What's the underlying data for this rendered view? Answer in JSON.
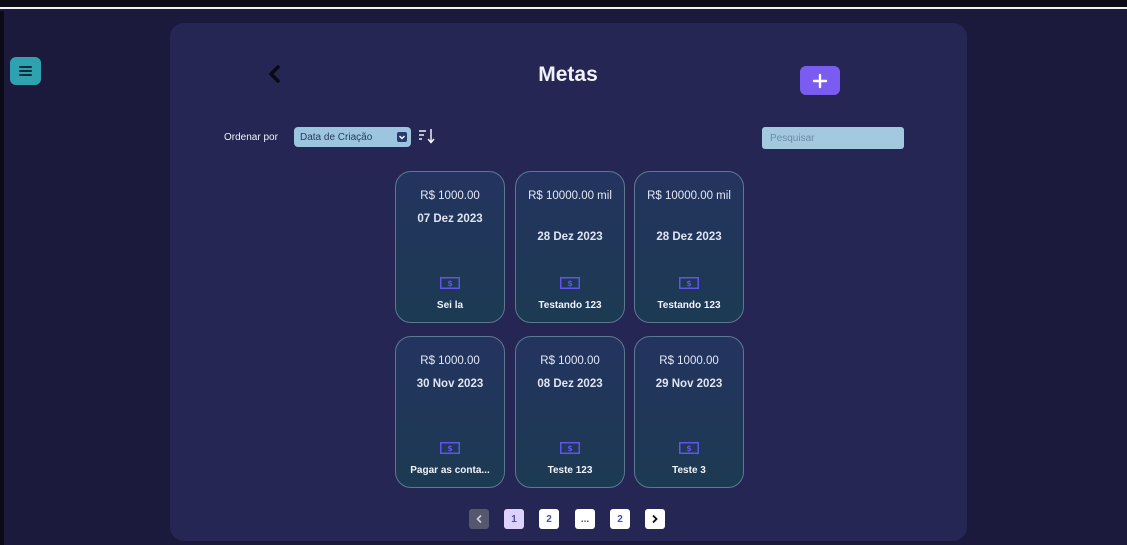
{
  "colors": {
    "background": "#1c1a3c",
    "panel": "#252653",
    "accent": "#7b5cf0",
    "menu_button": "#2ea2ae",
    "money_icon": "#5f55e8"
  },
  "nav": {
    "menu_icon": "hamburger-menu-icon"
  },
  "header": {
    "back_icon": "chevron-left-icon",
    "title": "Metas",
    "add_icon": "plus-icon"
  },
  "toolbar": {
    "sort_label": "Ordenar por",
    "sort_selected": "Data de Criação",
    "sort_order_icon": "sort-descending-icon",
    "search_placeholder": "Pesquisar"
  },
  "goals": [
    {
      "value": "R$ 1000.00",
      "date": "07 Dez 2023",
      "name": "Sei la"
    },
    {
      "value": "R$ 10000.00 mil",
      "date": "28 Dez 2023",
      "name": "Testando 123"
    },
    {
      "value": "R$ 10000.00 mil",
      "date": "28 Dez 2023",
      "name": "Testando 123"
    },
    {
      "value": "R$ 1000.00",
      "date": "30 Nov 2023",
      "name": "Pagar as conta..."
    },
    {
      "value": "R$ 1000.00",
      "date": "08 Dez 2023",
      "name": "Teste 123"
    },
    {
      "value": "R$ 1000.00",
      "date": "29 Nov 2023",
      "name": "Teste 3"
    }
  ],
  "goal_icon": "money-bill-icon",
  "pagination": {
    "prev_icon": "chevron-left-icon",
    "pages": [
      "1",
      "2",
      "...",
      "2"
    ],
    "current": "1",
    "next_icon": "chevron-right-icon"
  }
}
